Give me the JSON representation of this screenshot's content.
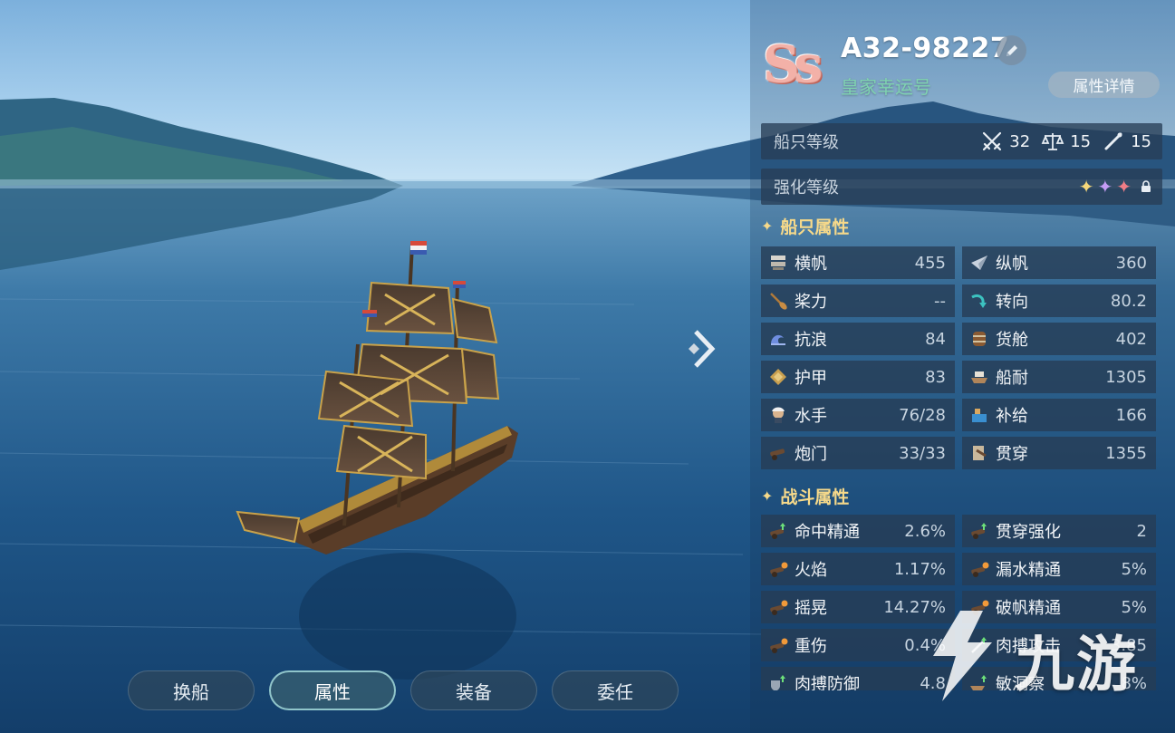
{
  "ship": {
    "grade": "Ss",
    "id": "A32-98227",
    "name": "皇家幸运号",
    "details_button": "属性详情"
  },
  "level_bar": {
    "label": "船只等级",
    "values": [
      {
        "icon": "crossed-swords-icon",
        "value": "32"
      },
      {
        "icon": "scales-icon",
        "value": "15"
      },
      {
        "icon": "spyglass-icon",
        "value": "15"
      }
    ]
  },
  "enhance_bar": {
    "label": "强化等级",
    "stars": [
      {
        "icon": "gold-star-icon",
        "color": "#f5d77a"
      },
      {
        "icon": "purple-star-icon",
        "color": "#c59cf5"
      },
      {
        "icon": "red-star-icon",
        "color": "#f07d86"
      }
    ],
    "locked": true
  },
  "ship_attributes": {
    "title": "船只属性",
    "items": [
      {
        "name": "横帆",
        "value": "455",
        "icon": "square-sail-icon"
      },
      {
        "name": "纵帆",
        "value": "360",
        "icon": "fore-aft-sail-icon"
      },
      {
        "name": "桨力",
        "value": "--",
        "icon": "oar-icon"
      },
      {
        "name": "转向",
        "value": "80.2",
        "icon": "turn-arrow-icon"
      },
      {
        "name": "抗浪",
        "value": "84",
        "icon": "wave-icon"
      },
      {
        "name": "货舱",
        "value": "402",
        "icon": "barrel-icon"
      },
      {
        "name": "护甲",
        "value": "83",
        "icon": "armor-plate-icon"
      },
      {
        "name": "船耐",
        "value": "1305",
        "icon": "hull-icon"
      },
      {
        "name": "水手",
        "value": "76/28",
        "icon": "sailor-icon"
      },
      {
        "name": "补给",
        "value": "166",
        "icon": "supply-icon"
      },
      {
        "name": "炮门",
        "value": "33/33",
        "icon": "cannon-icon"
      },
      {
        "name": "贯穿",
        "value": "1355",
        "icon": "pierce-icon"
      }
    ]
  },
  "combat_attributes": {
    "title": "战斗属性",
    "items": [
      {
        "name": "命中精通",
        "value": "2.6%",
        "icon": "cannon-up-icon"
      },
      {
        "name": "贯穿强化",
        "value": "2",
        "icon": "cannon-up-icon"
      },
      {
        "name": "火焰",
        "value": "1.17%",
        "icon": "cannon-fire-icon"
      },
      {
        "name": "漏水精通",
        "value": "5%",
        "icon": "cannon-fire-icon"
      },
      {
        "name": "摇晃",
        "value": "14.27%",
        "icon": "cannon-fire-icon"
      },
      {
        "name": "破帆精通",
        "value": "5%",
        "icon": "cannon-fire-icon"
      },
      {
        "name": "重伤",
        "value": "0.4%",
        "icon": "cannon-fire-icon"
      },
      {
        "name": "肉搏攻击",
        "value": "3.85",
        "icon": "sword-up-icon"
      },
      {
        "name": "肉搏防御",
        "value": "4.8",
        "icon": "shield-up-icon"
      },
      {
        "name": "敏洞察",
        "value": "8%",
        "icon": "hull-up-icon"
      }
    ]
  },
  "tabs": [
    {
      "label": "换船",
      "active": false
    },
    {
      "label": "属性",
      "active": true
    },
    {
      "label": "装备",
      "active": false
    },
    {
      "label": "委任",
      "active": false
    }
  ],
  "watermark": {
    "text": "九游"
  }
}
